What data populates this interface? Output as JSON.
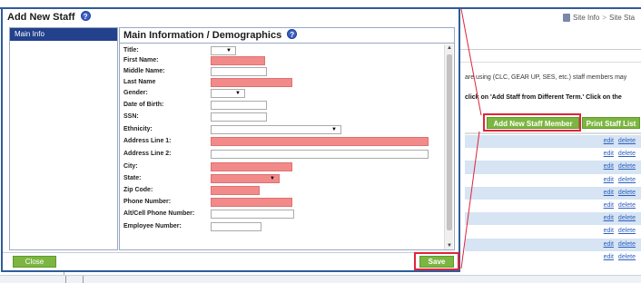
{
  "colors": {
    "accent": "#2e5c99",
    "button": "#7cb641",
    "required": "#f28a8a",
    "highlight": "#e0243a",
    "sidebar_selected": "#23418c",
    "row_alt": "#d6e4f3"
  },
  "background": {
    "breadcrumb": {
      "item1": "Site Info",
      "separator": ">",
      "item2": "Site Sta"
    },
    "text_line1": "are using (CLC, GEAR UP, SES, etc.) staff members may",
    "text_line2": "click on 'Add Staff from Different Term.' Click on the",
    "add_button": "Add New Staff Member",
    "print_button": "Print Staff List",
    "rows": [
      {
        "edit": "edit",
        "delete": "delete"
      },
      {
        "edit": "edit",
        "delete": "delete"
      },
      {
        "edit": "edit",
        "delete": "delete"
      },
      {
        "edit": "edit",
        "delete": "delete"
      },
      {
        "edit": "edit",
        "delete": "delete"
      },
      {
        "edit": "edit",
        "delete": "delete"
      },
      {
        "edit": "edit",
        "delete": "delete"
      },
      {
        "edit": "edit",
        "delete": "delete"
      },
      {
        "edit": "edit",
        "delete": "delete"
      },
      {
        "edit": "edit",
        "delete": "delete"
      }
    ]
  },
  "modal": {
    "title": "Add New Staff",
    "help_icon": "?",
    "sidebar": {
      "items": [
        {
          "label": "Main Info"
        }
      ]
    },
    "panel_title": "Main Information / Demographics",
    "fields": [
      {
        "label": "Title:",
        "type": "select",
        "required": false,
        "value": ""
      },
      {
        "label": "First Name:",
        "type": "text",
        "required": true,
        "value": ""
      },
      {
        "label": "Middle Name:",
        "type": "text",
        "required": false,
        "value": ""
      },
      {
        "label": "Last Name",
        "type": "text",
        "required": true,
        "value": ""
      },
      {
        "label": "Gender:",
        "type": "select",
        "required": false,
        "value": ""
      },
      {
        "label": "Date of Birth:",
        "type": "text",
        "required": false,
        "value": ""
      },
      {
        "label": "SSN:",
        "type": "text",
        "required": false,
        "value": ""
      },
      {
        "label": "Ethnicity:",
        "type": "select",
        "required": false,
        "value": ""
      },
      {
        "label": "Address Line 1:",
        "type": "text",
        "required": true,
        "value": ""
      },
      {
        "label": "Address Line 2:",
        "type": "text",
        "required": false,
        "value": ""
      },
      {
        "label": "City:",
        "type": "text",
        "required": true,
        "value": ""
      },
      {
        "label": "State:",
        "type": "select",
        "required": true,
        "value": ""
      },
      {
        "label": "Zip Code:",
        "type": "text",
        "required": true,
        "value": ""
      },
      {
        "label": "Phone Number:",
        "type": "text",
        "required": true,
        "value": ""
      },
      {
        "label": "Alt/Cell Phone Number:",
        "type": "text",
        "required": false,
        "value": ""
      },
      {
        "label": "Employee Number:",
        "type": "text",
        "required": false,
        "value": ""
      }
    ],
    "close_button": "Close",
    "save_button": "Save"
  }
}
